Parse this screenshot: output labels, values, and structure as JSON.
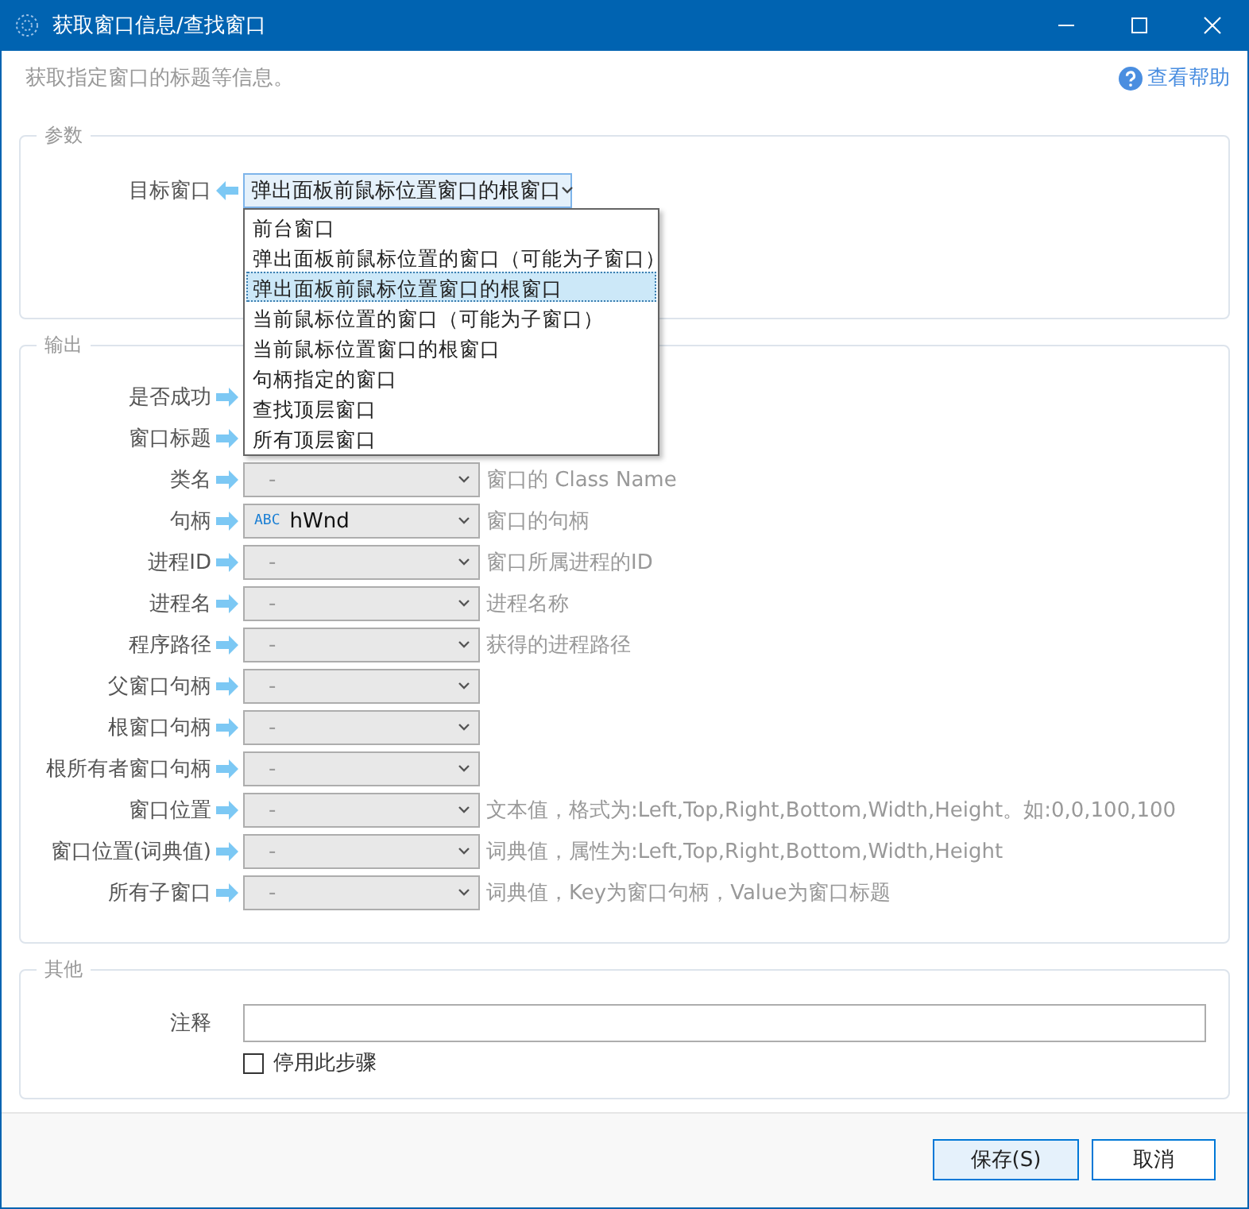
{
  "window": {
    "title": "获取窗口信息/查找窗口"
  },
  "description": "获取指定窗口的标题等信息。",
  "help_link": "查看帮助",
  "params": {
    "legend": "参数",
    "target": {
      "label": "目标窗口",
      "value": "弹出面板前鼠标位置窗口的根窗口",
      "expanded": true,
      "options": [
        {
          "label": "前台窗口",
          "selected": false
        },
        {
          "label": "弹出面板前鼠标位置的窗口（可能为子窗口）",
          "selected": false
        },
        {
          "label": "弹出面板前鼠标位置窗口的根窗口",
          "selected": true
        },
        {
          "label": "当前鼠标位置的窗口（可能为子窗口）",
          "selected": false
        },
        {
          "label": "当前鼠标位置窗口的根窗口",
          "selected": false
        },
        {
          "label": "句柄指定的窗口",
          "selected": false
        },
        {
          "label": "查找顶层窗口",
          "selected": false
        },
        {
          "label": "所有顶层窗口",
          "selected": false
        }
      ]
    }
  },
  "output": {
    "legend": "输出",
    "rows": [
      {
        "label": "是否成功",
        "kind": "covered"
      },
      {
        "label": "窗口标题",
        "kind": "covered"
      },
      {
        "label": "类名",
        "kind": "empty",
        "value": "-",
        "hint": "窗口的 Class Name"
      },
      {
        "label": "句柄",
        "kind": "variable",
        "type_tag": "ABC",
        "value": "hWnd",
        "hint": "窗口的句柄"
      },
      {
        "label": "进程ID",
        "kind": "empty",
        "value": "-",
        "hint": "窗口所属进程的ID"
      },
      {
        "label": "进程名",
        "kind": "empty",
        "value": "-",
        "hint": "进程名称"
      },
      {
        "label": "程序路径",
        "kind": "empty",
        "value": "-",
        "hint": "获得的进程路径"
      },
      {
        "label": "父窗口句柄",
        "kind": "empty",
        "value": "-"
      },
      {
        "label": "根窗口句柄",
        "kind": "empty",
        "value": "-"
      },
      {
        "label": "根所有者窗口句柄",
        "kind": "empty",
        "value": "-"
      },
      {
        "label": "窗口位置",
        "kind": "empty",
        "value": "-",
        "hint": "文本值，格式为:Left,Top,Right,Bottom,Width,Height。如:0,0,100,100"
      },
      {
        "label": "窗口位置(词典值)",
        "kind": "empty",
        "value": "-",
        "hint": "词典值，属性为:Left,Top,Right,Bottom,Width,Height"
      },
      {
        "label": "所有子窗口",
        "kind": "empty",
        "value": "-",
        "hint": "词典值，Key为窗口句柄，Value为窗口标题"
      }
    ]
  },
  "other": {
    "legend": "其他",
    "comment_label": "注释",
    "disable": {
      "label": "停用此步骤",
      "checked": false
    }
  },
  "buttons": [
    {
      "label": "保存(S)",
      "kind": "primary"
    },
    {
      "label": "取消",
      "kind": "secondary"
    }
  ]
}
